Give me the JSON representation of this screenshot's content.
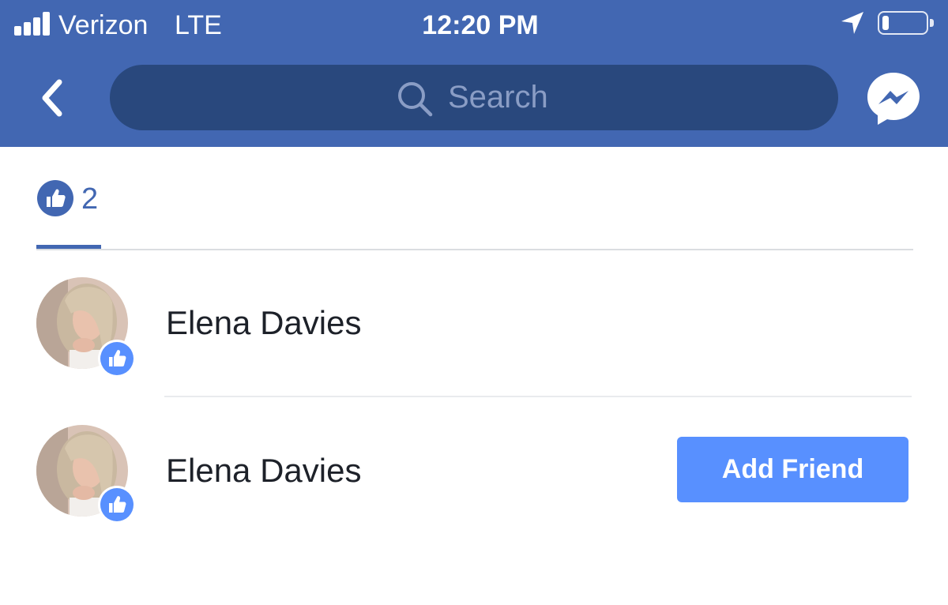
{
  "status_bar": {
    "carrier": "Verizon",
    "network": "LTE",
    "time": "12:20 PM",
    "battery_level": 0.15
  },
  "nav": {
    "search_placeholder": "Search",
    "back_icon": "chevron-left-icon",
    "messenger_icon": "messenger-icon"
  },
  "tabs": [
    {
      "icon": "like-icon",
      "count": "2",
      "selected": true
    }
  ],
  "reactions": [
    {
      "name": "Elena Davies",
      "reaction": "like",
      "action": null
    },
    {
      "name": "Elena Davies",
      "reaction": "like",
      "action": "Add Friend"
    }
  ],
  "colors": {
    "header_bg": "#4267b2",
    "search_bg": "#29487d",
    "accent": "#4267b2",
    "button_bg": "#5890ff",
    "like_badge": "#5890ff",
    "text": "#1d2129"
  }
}
